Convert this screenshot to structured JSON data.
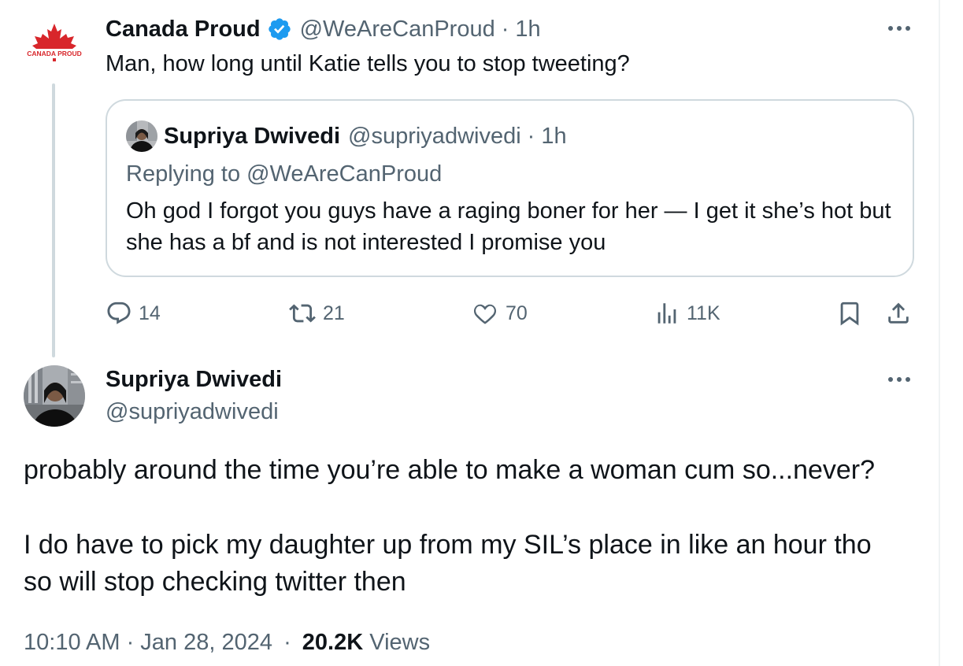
{
  "parent_tweet": {
    "author_name": "Canada Proud",
    "verified": true,
    "handle": "@WeAreCanProud",
    "time": "1h",
    "text": "Man, how long until Katie tells you to stop tweeting?",
    "logo_text": "CANADA PROUD",
    "actions": {
      "replies": "14",
      "reposts": "21",
      "likes": "70",
      "views": "11K"
    }
  },
  "quoted_tweet": {
    "author_name": "Supriya Dwivedi",
    "handle": "@supriyadwivedi",
    "time": "1h",
    "replying_to": "Replying to @WeAreCanProud",
    "text": "Oh god I forgot you guys have a raging boner for her — I get it she’s hot but she has a bf and is not interested I promise you"
  },
  "main_tweet": {
    "author_name": "Supriya Dwivedi",
    "handle": "@supriyadwivedi",
    "paragraph_1": "probably around the time you’re able to make a woman cum so...never?",
    "paragraph_2_line_1": "I do have to pick my daughter up from my SIL’s place in like an hour tho",
    "paragraph_2_line_2": "so will stop checking twitter then",
    "timestamp": "10:10 AM · Jan 28, 2024",
    "views_count": "20.2K",
    "views_label": "Views"
  },
  "separator": "·",
  "colors": {
    "text": "#0f1419",
    "muted": "#536471",
    "verified_blue": "#1d9bf0",
    "border": "#cfd9de",
    "brand_red": "#d8262b"
  },
  "icons": [
    "canada-proud-logo",
    "verified-badge-icon",
    "more-options-icon",
    "reply-icon",
    "repost-icon",
    "like-icon",
    "views-icon",
    "bookmark-icon",
    "share-icon"
  ]
}
